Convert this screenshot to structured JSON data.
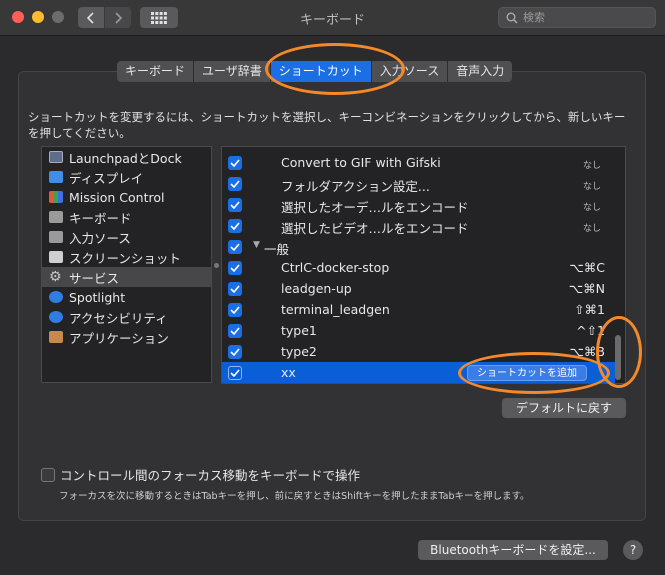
{
  "window": {
    "title": "キーボード",
    "search_placeholder": "検索"
  },
  "tabs": [
    {
      "label": "キーボード",
      "active": false
    },
    {
      "label": "ユーザ辞書",
      "active": false
    },
    {
      "label": "ショートカット",
      "active": true
    },
    {
      "label": "入力ソース",
      "active": false
    },
    {
      "label": "音声入力",
      "active": false
    }
  ],
  "instruction": "ショートカットを変更するには、ショートカットを選択し、キーコンビネーションをクリックしてから、新しいキーを押してください。",
  "categories": [
    {
      "label": "LaunchpadとDock",
      "icon": "launchpad-icon",
      "color": "#5c6e8c"
    },
    {
      "label": "ディスプレイ",
      "icon": "display-icon",
      "color": "#3f8ee8"
    },
    {
      "label": "Mission Control",
      "icon": "mission-control-icon",
      "color": "#7a4f2a"
    },
    {
      "label": "キーボード",
      "icon": "keyboard-icon",
      "color": "#9a9a9a"
    },
    {
      "label": "入力ソース",
      "icon": "input-source-icon",
      "color": "#9a9a9a"
    },
    {
      "label": "スクリーンショット",
      "icon": "screenshot-icon",
      "color": "#cfcfcf"
    },
    {
      "label": "サービス",
      "icon": "gear-icon",
      "color": "#b0b0b0",
      "selected": true
    },
    {
      "label": "Spotlight",
      "icon": "spotlight-icon",
      "color": "#2f7de0"
    },
    {
      "label": "アクセシビリティ",
      "icon": "accessibility-icon",
      "color": "#2f7de0"
    },
    {
      "label": "アプリケーション",
      "icon": "app-store-icon",
      "color": "#c88a4a"
    }
  ],
  "shortcuts": [
    {
      "name": "Convert to GIF with Gifski",
      "keys": "なし",
      "none": true
    },
    {
      "name": "フォルダアクション設定...",
      "keys": "なし",
      "none": true
    },
    {
      "name": "選択したオーデ…ルをエンコード",
      "keys": "なし",
      "none": true
    },
    {
      "name": "選択したビデオ…ルをエンコード",
      "keys": "なし",
      "none": true
    },
    {
      "name": "一般",
      "keys": "",
      "group": true
    },
    {
      "name": "CtrlC-docker-stop",
      "keys": "⌥⌘C"
    },
    {
      "name": "leadgen-up",
      "keys": "⌥⌘N"
    },
    {
      "name": "terminal_leadgen",
      "keys": "⇧⌘1"
    },
    {
      "name": "type1",
      "keys": "^⇧1"
    },
    {
      "name": "type2",
      "keys": "⌥⌘B"
    },
    {
      "name": "xx",
      "keys": "",
      "selected": true,
      "add_button": "ショートカットを追加"
    }
  ],
  "buttons": {
    "restore_defaults": "デフォルトに戻す",
    "bluetooth": "Bluetoothキーボードを設定...",
    "help": "?"
  },
  "focus_option": {
    "label": "コントロール間のフォーカス移動をキーボードで操作",
    "description": "フォーカスを次に移動するときはTabキーを押し、前に戻すときはShiftキーを押したままTabキーを押します。",
    "checked": false
  },
  "colors": {
    "accent": "#1b6fe3",
    "annotation": "#f4892a",
    "background": "#2b2b2d"
  }
}
